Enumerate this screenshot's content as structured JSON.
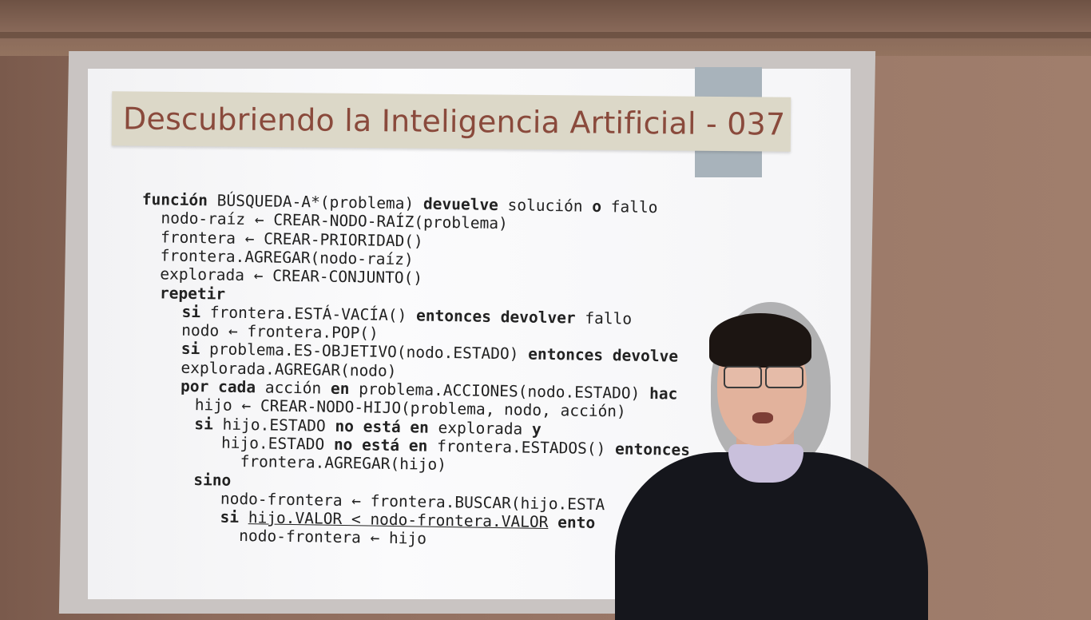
{
  "slide": {
    "title": "Descubriendo la Inteligencia Artificial - 037",
    "code_lines": [
      {
        "indent": 0,
        "parts": [
          {
            "t": "función",
            "b": true
          },
          {
            "t": " BÚSQUEDA-A*(problema) "
          },
          {
            "t": "devuelve",
            "b": true
          },
          {
            "t": " solución "
          },
          {
            "t": "o",
            "b": true
          },
          {
            "t": " fallo"
          }
        ]
      },
      {
        "indent": 1,
        "parts": [
          {
            "t": "nodo-raíz ← CREAR-NODO-RAÍZ(problema)"
          }
        ]
      },
      {
        "indent": 1,
        "parts": [
          {
            "t": "frontera ← CREAR-PRIORIDAD()"
          }
        ]
      },
      {
        "indent": 1,
        "parts": [
          {
            "t": "frontera.AGREGAR(nodo-raíz)"
          }
        ]
      },
      {
        "indent": 1,
        "parts": [
          {
            "t": "explorada ← CREAR-CONJUNTO()"
          }
        ]
      },
      {
        "indent": 1,
        "parts": [
          {
            "t": "repetir",
            "b": true
          }
        ]
      },
      {
        "indent": 2,
        "parts": [
          {
            "t": "si",
            "b": true
          },
          {
            "t": " frontera.ESTÁ-VACÍA() "
          },
          {
            "t": "entonces devolver",
            "b": true
          },
          {
            "t": " fallo"
          }
        ]
      },
      {
        "indent": 2,
        "parts": [
          {
            "t": "nodo ← frontera.POP()"
          }
        ]
      },
      {
        "indent": 2,
        "parts": [
          {
            "t": "si",
            "b": true
          },
          {
            "t": " problema.ES-OBJETIVO(nodo.ESTADO) "
          },
          {
            "t": "entonces devolve",
            "b": true
          }
        ]
      },
      {
        "indent": 2,
        "parts": [
          {
            "t": "explorada.AGREGAR(nodo)"
          }
        ]
      },
      {
        "indent": 2,
        "parts": [
          {
            "t": "por cada",
            "b": true
          },
          {
            "t": " acción "
          },
          {
            "t": "en",
            "b": true
          },
          {
            "t": " problema.ACCIONES(nodo.ESTADO) "
          },
          {
            "t": "hac",
            "b": true
          }
        ]
      },
      {
        "indent": 3,
        "parts": [
          {
            "t": "hijo ← CREAR-NODO-HIJO(problema, nodo, acción)"
          }
        ]
      },
      {
        "indent": 3,
        "parts": [
          {
            "t": "si",
            "b": true
          },
          {
            "t": " hijo.ESTADO "
          },
          {
            "t": "no está en",
            "b": true
          },
          {
            "t": " explorada "
          },
          {
            "t": "y",
            "b": true
          }
        ]
      },
      {
        "indent": 4,
        "parts": [
          {
            "t": "hijo.ESTADO "
          },
          {
            "t": "no está en",
            "b": true
          },
          {
            "t": " frontera.ESTADOS() "
          },
          {
            "t": "entonces",
            "b": true
          }
        ]
      },
      {
        "indent": 5,
        "parts": [
          {
            "t": "frontera.AGREGAR(hijo)"
          }
        ]
      },
      {
        "indent": 3,
        "parts": [
          {
            "t": "sino",
            "b": true
          }
        ]
      },
      {
        "indent": 4,
        "parts": [
          {
            "t": "nodo-frontera ← frontera.BUSCAR(hijo.ESTA"
          }
        ]
      },
      {
        "indent": 4,
        "parts": [
          {
            "t": "si",
            "b": true
          },
          {
            "t": " "
          },
          {
            "t": "hijo.VALOR < nodo-frontera.VALOR",
            "u": true
          },
          {
            "t": " "
          },
          {
            "t": "ento",
            "b": true
          }
        ]
      },
      {
        "indent": 5,
        "parts": [
          {
            "t": "nodo-frontera ← hijo"
          }
        ]
      }
    ]
  }
}
